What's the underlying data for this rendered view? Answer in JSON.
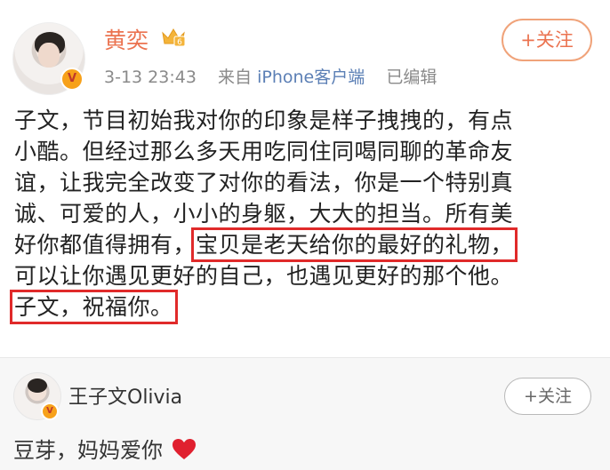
{
  "post": {
    "author": "黄奕",
    "timestamp": "3-13 23:43",
    "source_prefix": "来自",
    "source": "iPhone客户端",
    "edited": "已编辑",
    "follow_label": "+关注",
    "verified_badge": "V",
    "text_lines": [
      "子文，节目初始我对你的印象是样子拽拽的，有点",
      "小酷。但经过那么多天用吃同住同喝同聊的革命友",
      "谊，让我完全改变了对你的看法，你是一个特别真",
      "诚、可爱的人，小小的身躯，大大的担当。所有美"
    ],
    "line5_prefix": "好你都值得拥有，",
    "line5_highlight": "宝贝是老天给你的最好的礼物，",
    "line6": "可以让你遇见更好的自己，也遇见更好的那个他。",
    "line7_highlight": "子文，祝福你。",
    "highlight_color": "#e02a2a",
    "name_color": "#eb7350"
  },
  "reply": {
    "author": "王子文Olivia",
    "follow_label": "+关注",
    "verified_badge": "V",
    "text": "豆芽，妈妈爱你",
    "heart_icon": "heart-icon",
    "heart_color": "#e0202f"
  }
}
